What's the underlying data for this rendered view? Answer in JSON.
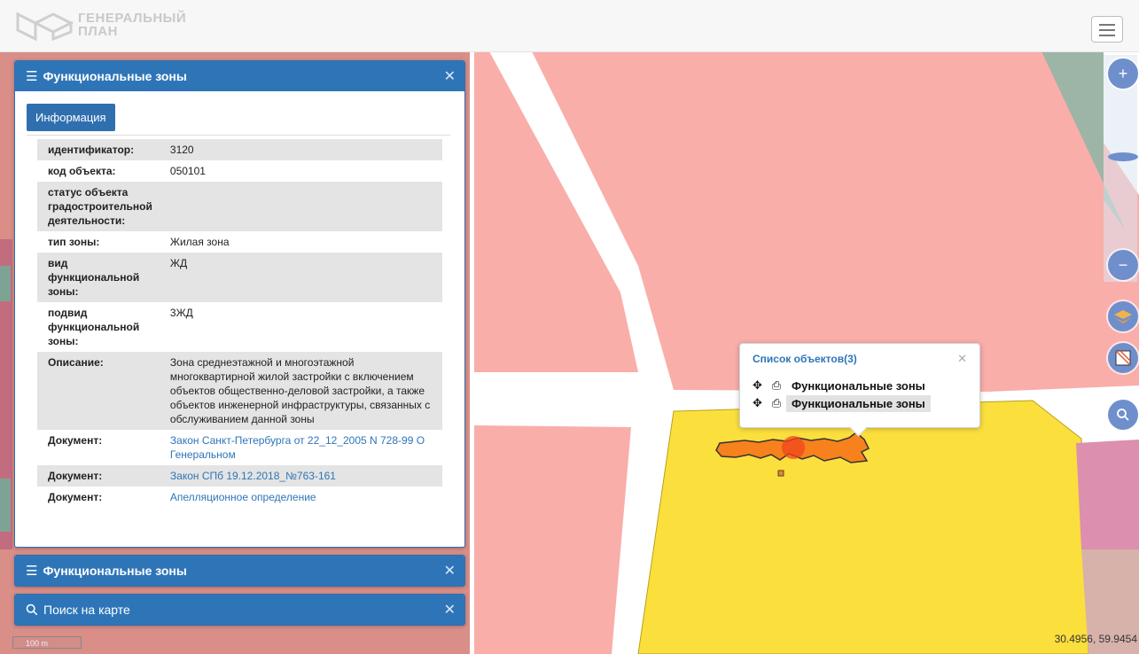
{
  "header": {
    "logo_line1": "ГЕНЕРАЛЬНЫЙ",
    "logo_line2": "ПЛАН"
  },
  "info_panel": {
    "title": "Функциональные зоны",
    "tab_label": "Информация",
    "rows": [
      {
        "key": "идентификатор:",
        "value": "3120"
      },
      {
        "key": "код объекта:",
        "value": "050101"
      },
      {
        "key": "статус объекта градостроительной деятельности:",
        "value": ""
      },
      {
        "key": "тип зоны:",
        "value": "Жилая зона"
      },
      {
        "key": "вид функциональной зоны:",
        "value": "ЖД"
      },
      {
        "key": "подвид функциональной зоны:",
        "value": "3ЖД"
      },
      {
        "key": "Описание:",
        "value": "Зона среднеэтажной и многоэтажной многоквартирной жилой застройки с включением объектов общественно-деловой застройки, а также объектов инженерной инфраструктуры, связанных с обслуживанием данной зоны"
      },
      {
        "key": "Документ:",
        "value": "Закон Санкт-Петербурга от 22_12_2005 N 728-99 О Генеральном"
      },
      {
        "key": "Документ:",
        "value": "Закон СПб 19.12.2018_№763-161"
      },
      {
        "key": "Документ:",
        "value": "Апелляционное определение"
      }
    ]
  },
  "collapsed_panel": {
    "title": "Функциональные зоны"
  },
  "search_panel": {
    "title": "Поиск на карте"
  },
  "popup": {
    "title": "Список объектов(3)",
    "items": [
      "Функциональные зоны",
      "Функциональные зоны"
    ]
  },
  "map": {
    "coords": "30.4956, 59.9454",
    "scale_label": "100 m"
  },
  "icons": {
    "zoom_in": "plus-icon",
    "zoom_out": "minus-icon",
    "layers": "layers-icon",
    "basemap": "basemap-icon",
    "search": "search-icon"
  },
  "colors": {
    "accent": "#2e75b8",
    "residential_zone": "#fbdf3d",
    "pink_zone": "#f9aeaa",
    "selected_object": "#f7811d"
  }
}
